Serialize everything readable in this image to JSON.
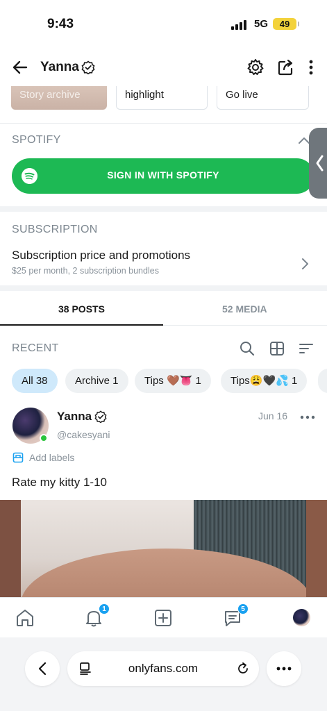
{
  "status_bar": {
    "time": "9:43",
    "network": "5G",
    "battery": "49"
  },
  "header": {
    "title": "Yanna",
    "verified": true
  },
  "story_row": {
    "items": [
      "Story archive",
      "highlight",
      "Go live"
    ]
  },
  "spotify": {
    "section_label": "SPOTIFY",
    "button_label": "SIGN IN WITH SPOTIFY",
    "accent": "#1db954"
  },
  "subscription": {
    "section_label": "SUBSCRIPTION",
    "title": "Subscription price and promotions",
    "description": "$25 per month, 2 subscription bundles"
  },
  "tabs": [
    {
      "label": "38 POSTS",
      "active": true
    },
    {
      "label": "52 MEDIA",
      "active": false
    }
  ],
  "recent": {
    "label": "RECENT",
    "filters": [
      {
        "label": "All 38",
        "active": true
      },
      {
        "label": "Archive 1",
        "active": false
      },
      {
        "label": "Tips 🤎👅 1",
        "active": false
      },
      {
        "label": "Tips😩🖤💦 1",
        "active": false
      }
    ]
  },
  "post": {
    "name": "Yanna",
    "handle": "@cakesyani",
    "date": "Jun 16",
    "add_labels": "Add labels",
    "text": "Rate my kitty 1-10"
  },
  "bottom_nav": {
    "notifications_badge": "1",
    "messages_badge": "5"
  },
  "browser": {
    "url": "onlyfans.com"
  },
  "colors": {
    "accent_blue": "#1aa1f0",
    "chip_active": "#cfe9fb",
    "muted_text": "#8a939b"
  }
}
